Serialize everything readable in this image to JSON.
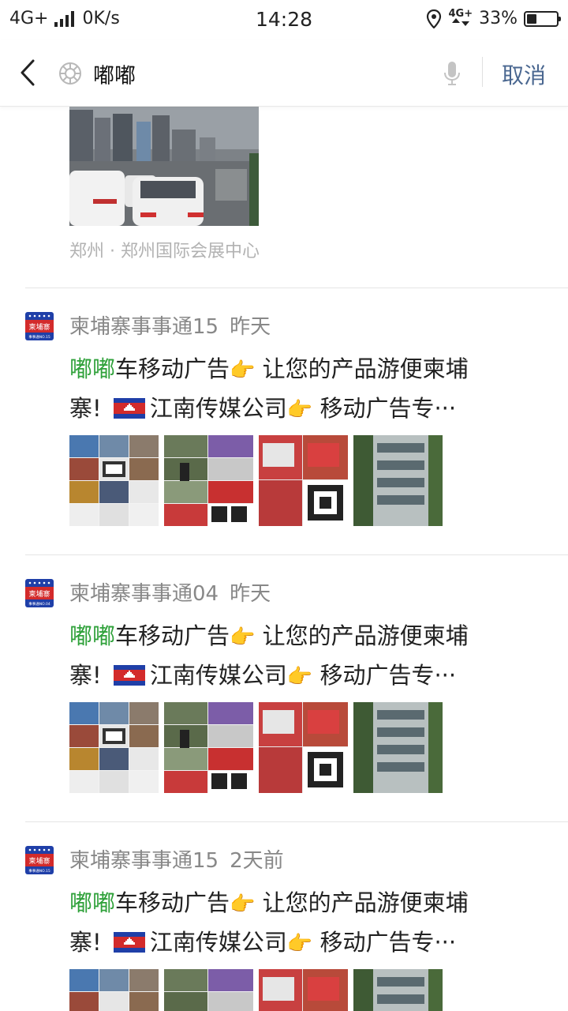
{
  "status_bar": {
    "network": "4G+",
    "speed": "0K/s",
    "time": "14:28",
    "net_right_top": "4G",
    "net_right_bottom": "+",
    "battery": "33%",
    "battery_level": 0.33
  },
  "search": {
    "query": "嘟嘟",
    "cancel_label": "取消"
  },
  "top_item": {
    "location": "郑州 · 郑州国际会展中心"
  },
  "results": [
    {
      "account": "柬埔寨事事通15",
      "time": "昨天",
      "highlight": "嘟嘟",
      "line1_rest": "车移动广告",
      "line1_tail": "让您的产品游便柬埔",
      "line2_start": "寨!",
      "line2_mid": "江南传媒公司",
      "line2_tail": "移动广告专···",
      "avatar_text": "柬埔寨",
      "avatar_sub": "事事通NO.15"
    },
    {
      "account": "柬埔寨事事通04",
      "time": "昨天",
      "highlight": "嘟嘟",
      "line1_rest": "车移动广告",
      "line1_tail": "让您的产品游便柬埔",
      "line2_start": "寨!",
      "line2_mid": "江南传媒公司",
      "line2_tail": "移动广告专···",
      "avatar_text": "柬埔寨",
      "avatar_sub": "事事通NO.04"
    },
    {
      "account": "柬埔寨事事通15",
      "time": "2天前",
      "highlight": "嘟嘟",
      "line1_rest": "车移动广告",
      "line1_tail": "让您的产品游便柬埔",
      "line2_start": "寨!",
      "line2_mid": "江南传媒公司",
      "line2_tail": "移动广告专···",
      "avatar_text": "柬埔寨",
      "avatar_sub": "事事通NO.15"
    }
  ],
  "emoji": "👉",
  "colors": {
    "highlight": "#2fa13a",
    "cancel": "#4a6790",
    "meta": "#888888"
  }
}
